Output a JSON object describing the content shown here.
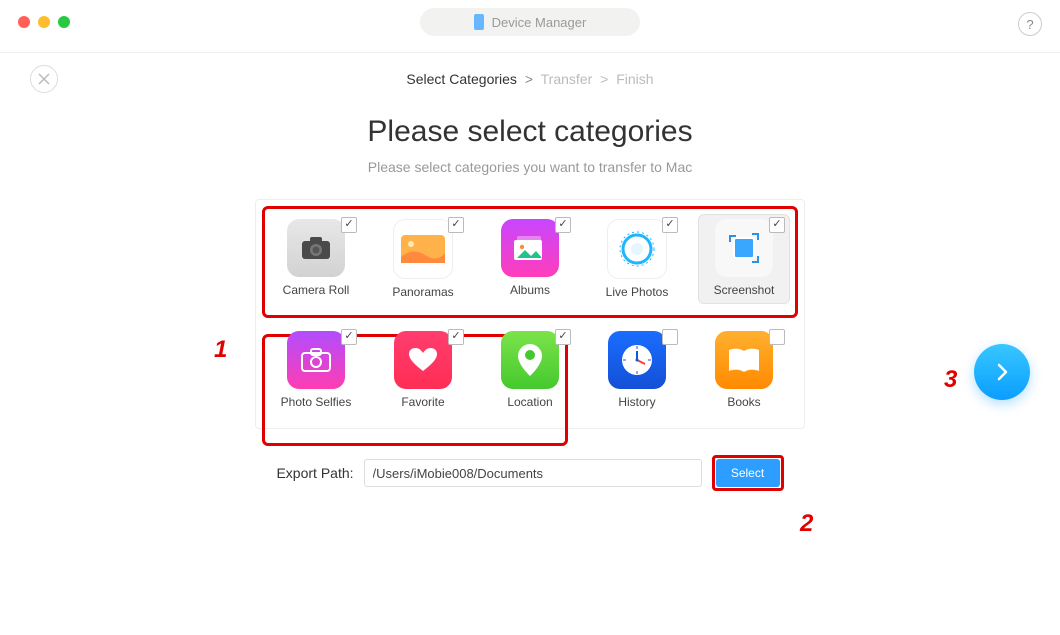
{
  "titlebar": {
    "label": "Device Manager"
  },
  "breadcrumb": {
    "step1": "Select Categories",
    "step2": "Transfer",
    "step3": "Finish"
  },
  "hero": {
    "title": "Please select categories",
    "subtitle": "Please select categories you want to transfer to Mac"
  },
  "categories": {
    "row1": [
      {
        "label": "Camera Roll",
        "checked": true
      },
      {
        "label": "Panoramas",
        "checked": true
      },
      {
        "label": "Albums",
        "checked": true
      },
      {
        "label": "Live Photos",
        "checked": true
      },
      {
        "label": "Screenshot",
        "checked": true,
        "selected": true
      }
    ],
    "row2": [
      {
        "label": "Photo Selfies",
        "checked": true
      },
      {
        "label": "Favorite",
        "checked": true
      },
      {
        "label": "Location",
        "checked": true
      },
      {
        "label": "History",
        "checked": false
      },
      {
        "label": "Books",
        "checked": false
      }
    ]
  },
  "export": {
    "label": "Export Path:",
    "path": "/Users/iMobie008/Documents",
    "button": "Select"
  },
  "annotations": {
    "a1": "1",
    "a2": "2",
    "a3": "3"
  },
  "help": {
    "symbol": "?"
  }
}
